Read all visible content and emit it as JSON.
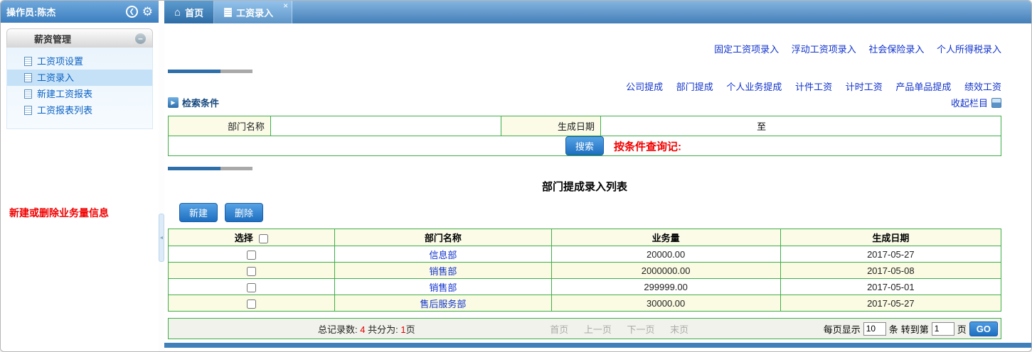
{
  "colors": {
    "accent_blue": "#2e75b6",
    "table_border_green": "#3fae49",
    "annotation_red": "#ff0000"
  },
  "icons": {
    "back": "❮",
    "gear": "⚙",
    "minus": "–",
    "home": "⌂",
    "close": "×",
    "play": "▶",
    "splitter": "◄"
  },
  "sidebar": {
    "operator_label": "操作员:陈杰",
    "panel_title": "薪资管理",
    "items": [
      {
        "label": "工资项设置"
      },
      {
        "label": "工资录入"
      },
      {
        "label": "新建工资报表"
      },
      {
        "label": "工资报表列表"
      }
    ],
    "annotation": "新建或删除业务量信息"
  },
  "tabs": [
    {
      "label": "首页"
    },
    {
      "label": "工资录入"
    }
  ],
  "top_links": [
    "固定工资项录入",
    "浮动工资项录入",
    "社会保险录入",
    "个人所得税录入"
  ],
  "category_links": [
    "公司提成",
    "部门提成",
    "个人业务提成",
    "计件工资",
    "计时工资",
    "产品单品提成",
    "绩效工资"
  ],
  "collapse_label": "收起栏目",
  "search": {
    "section_title": "检索条件",
    "dept_label": "部门名称",
    "date_label": "生成日期",
    "to_label": "至",
    "search_button": "搜索",
    "annotation": "按条件查询记:"
  },
  "list": {
    "title": "部门提成录入列表",
    "new_button": "新建",
    "delete_button": "删除",
    "columns": [
      "选择",
      "部门名称",
      "业务量",
      "生成日期"
    ],
    "rows": [
      {
        "dept": "信息部",
        "volume": "20000.00",
        "date": "2017-05-27"
      },
      {
        "dept": "销售部",
        "volume": "2000000.00",
        "date": "2017-05-08"
      },
      {
        "dept": "销售部",
        "volume": "299999.00",
        "date": "2017-05-01"
      },
      {
        "dept": "售后服务部",
        "volume": "30000.00",
        "date": "2017-05-27"
      }
    ]
  },
  "footer": {
    "total_label": "总记录数:",
    "total_value": "4",
    "pages_label": "共分为:",
    "pages_value": "1",
    "pages_unit": "页",
    "pagination": [
      "首页",
      "上一页",
      "下一页",
      "末页"
    ],
    "per_page_label": "每页显示",
    "per_page_value": "10",
    "per_page_unit": "条",
    "goto_label": "转到第",
    "goto_value": "1",
    "goto_unit": "页",
    "go_button": "GO"
  }
}
